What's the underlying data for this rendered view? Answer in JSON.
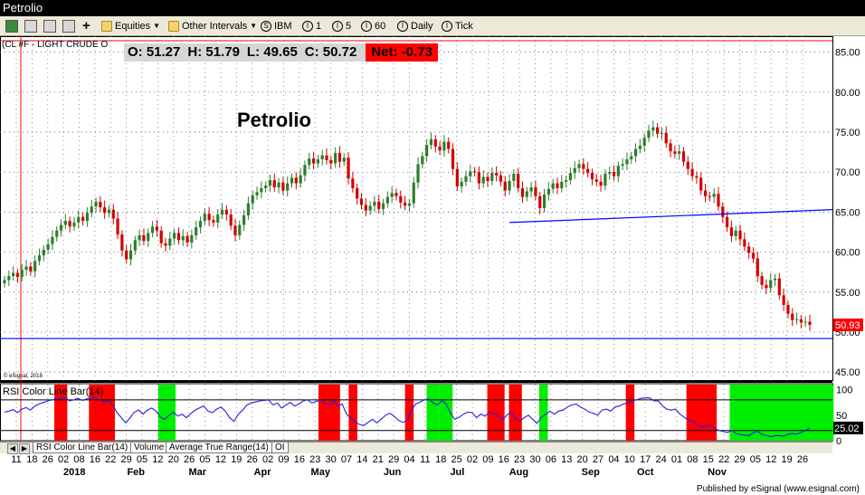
{
  "window": {
    "title": "Petrolio"
  },
  "toolbar": {
    "items": [
      {
        "name": "equities-menu",
        "label": "Equities",
        "icon": "folder-icon",
        "dropdown": true
      },
      {
        "name": "other-intervals-menu",
        "label": "Other Intervals",
        "icon": "folder-icon",
        "dropdown": true
      },
      {
        "name": "ibm-symbol",
        "label": "IBM",
        "icon": "circle-s-icon",
        "glyph": "S"
      },
      {
        "name": "interval-1",
        "label": "1",
        "icon": "circle-i-icon",
        "glyph": "I"
      },
      {
        "name": "interval-5",
        "label": "5",
        "icon": "circle-i-icon",
        "glyph": "I"
      },
      {
        "name": "interval-60",
        "label": "60",
        "icon": "circle-i-icon",
        "glyph": "I"
      },
      {
        "name": "interval-daily",
        "label": "Daily",
        "icon": "circle-i-icon",
        "glyph": "I"
      },
      {
        "name": "interval-tick",
        "label": "Tick",
        "icon": "circle-i-icon",
        "glyph": "I"
      }
    ]
  },
  "quote": {
    "symbol_label": "(CL #F - LIGHT CRUDE O",
    "open_label": "O: 51.27",
    "high_label": "H: 51.79",
    "low_label": "L: 49.65",
    "close_label": "C: 50.72",
    "net_label": "Net: -0.73"
  },
  "colors": {
    "up": "#2e7d2e",
    "down": "#d10000",
    "trend": "#0000ff",
    "rsi_line": "#2222dd",
    "rsi_ob": "#ff0000",
    "rsi_os": "#00ee00"
  },
  "chart_data": [
    {
      "type": "candlestick",
      "title": "Petrolio",
      "copyright": "© eSignal, 2018",
      "ylim": [
        44,
        87
      ],
      "yticks": [
        "85.00",
        "80.00",
        "75.00",
        "70.00",
        "65.00",
        "60.00",
        "55.00",
        "50.00",
        "45.00"
      ],
      "ytick_values": [
        85,
        80,
        75,
        70,
        65,
        60,
        55,
        50,
        45
      ],
      "last_price_label": "50.93",
      "support_line": 49.2,
      "trendline": {
        "from": [
          116,
          63.7
        ],
        "to": [
          231,
          66.2
        ]
      },
      "close": [
        56.5,
        57.0,
        57.4,
        56.9,
        57.8,
        58.2,
        57.6,
        58.9,
        59.6,
        60.3,
        61.0,
        61.9,
        62.7,
        63.4,
        63.9,
        63.2,
        63.7,
        64.4,
        63.9,
        64.9,
        65.7,
        66.3,
        65.6,
        64.9,
        65.3,
        64.2,
        62.2,
        60.2,
        59.1,
        60.2,
        61.5,
        62.1,
        61.4,
        62.4,
        63.2,
        62.7,
        61.1,
        60.8,
        61.7,
        62.4,
        61.5,
        62.0,
        61.2,
        62.1,
        63.1,
        63.9,
        64.8,
        64.0,
        63.7,
        64.7,
        65.3,
        64.7,
        63.3,
        62.1,
        63.4,
        64.6,
        66.1,
        67.1,
        67.5,
        68.0,
        68.3,
        69.0,
        68.1,
        68.7,
        67.7,
        68.6,
        69.3,
        68.6,
        69.6,
        70.9,
        71.7,
        71.1,
        71.6,
        72.1,
        71.5,
        71.1,
        72.4,
        71.3,
        71.8,
        69.2,
        68.0,
        66.7,
        65.9,
        65.2,
        65.8,
        66.3,
        65.4,
        66.1,
        66.9,
        67.4,
        67.0,
        66.2,
        65.8,
        66.1,
        68.7,
        71.0,
        72.0,
        73.4,
        74.1,
        73.2,
        72.7,
        73.8,
        72.9,
        70.4,
        68.2,
        68.8,
        69.5,
        70.1,
        70.0,
        68.6,
        69.4,
        68.9,
        69.9,
        69.6,
        68.8,
        67.7,
        68.9,
        69.8,
        68.0,
        66.9,
        67.6,
        68.1,
        67.0,
        65.5,
        67.2,
        67.9,
        68.6,
        68.0,
        68.8,
        69.0,
        69.9,
        70.5,
        71.0,
        70.4,
        69.9,
        69.1,
        68.8,
        68.3,
        69.8,
        70.0,
        69.5,
        70.8,
        71.0,
        71.6,
        72.0,
        72.9,
        73.3,
        74.3,
        75.2,
        75.6,
        74.8,
        74.9,
        73.6,
        72.6,
        72.3,
        72.6,
        71.3,
        70.4,
        69.5,
        69.3,
        67.7,
        67.0,
        66.9,
        67.3,
        65.7,
        64.4,
        63.1,
        62.0,
        62.7,
        61.6,
        60.7,
        59.9,
        59.2,
        57.0,
        55.9,
        55.5,
        56.5,
        56.7,
        54.6,
        53.4,
        52.3,
        51.5,
        51.6,
        51.2,
        51.3,
        50.9
      ]
    },
    {
      "type": "line",
      "title": "RSI Color Line Bar(14)",
      "ylim": [
        0,
        110
      ],
      "yticks": [
        "100",
        "50",
        "0"
      ],
      "ytick_values": [
        100,
        50,
        0
      ],
      "reference_lines": [
        80,
        20
      ],
      "last_value_label": "25.02",
      "overbought_bars": [
        [
          12,
          14
        ],
        [
          20,
          25
        ],
        [
          73,
          74
        ],
        [
          75,
          77
        ],
        [
          80,
          81
        ],
        [
          93,
          94
        ],
        [
          112,
          115
        ],
        [
          117,
          119
        ],
        [
          144,
          145
        ],
        [
          158,
          164
        ]
      ],
      "oversold_bars": [
        [
          36,
          39
        ],
        [
          98,
          100
        ],
        [
          101,
          103
        ],
        [
          124,
          125
        ],
        [
          168,
          191
        ]
      ],
      "values": [
        56,
        58,
        61,
        55,
        62,
        65,
        60,
        68,
        72,
        75,
        78,
        80,
        82,
        84,
        85,
        78,
        80,
        83,
        79,
        82,
        84,
        85,
        80,
        76,
        78,
        70,
        55,
        45,
        35,
        45,
        56,
        60,
        52,
        60,
        64,
        58,
        46,
        42,
        50,
        56,
        48,
        52,
        45,
        53,
        60,
        64,
        68,
        58,
        55,
        62,
        66,
        58,
        45,
        38,
        52,
        60,
        70,
        74,
        76,
        78,
        79,
        80,
        70,
        74,
        64,
        70,
        75,
        68,
        72,
        78,
        80,
        74,
        77,
        80,
        74,
        70,
        80,
        68,
        72,
        52,
        44,
        36,
        32,
        30,
        36,
        42,
        35,
        42,
        50,
        54,
        48,
        40,
        36,
        40,
        60,
        72,
        76,
        80,
        82,
        74,
        70,
        78,
        72,
        54,
        42,
        46,
        52,
        56,
        55,
        45,
        52,
        48,
        56,
        54,
        48,
        40,
        50,
        56,
        44,
        38,
        45,
        50,
        42,
        34,
        46,
        52,
        58,
        52,
        58,
        60,
        66,
        70,
        72,
        66,
        62,
        56,
        54,
        50,
        60,
        62,
        58,
        66,
        68,
        72,
        74,
        78,
        80,
        83,
        84,
        84,
        78,
        78,
        68,
        62,
        60,
        62,
        52,
        46,
        40,
        38,
        30,
        28,
        28,
        31,
        24,
        20,
        18,
        16,
        20,
        14,
        12,
        11,
        10,
        16,
        18,
        12,
        10,
        8,
        10,
        10,
        9,
        13,
        14,
        13,
        16,
        20,
        25
      ]
    }
  ],
  "x_axis": {
    "day_labels": [
      "11",
      "18",
      "26",
      "02",
      "08",
      "16",
      "22",
      "29",
      "05",
      "12",
      "20",
      "26",
      "05",
      "12",
      "19",
      "26",
      "02",
      "09",
      "16",
      "23",
      "30",
      "07",
      "14",
      "21",
      "29",
      "04",
      "11",
      "18",
      "25",
      "02",
      "09",
      "16",
      "23",
      "30",
      "06",
      "13",
      "20",
      "27",
      "04",
      "10",
      "17",
      "24",
      "01",
      "08",
      "15",
      "22",
      "29",
      "05",
      "12",
      "19",
      "26"
    ],
    "months": [
      {
        "label": "2018",
        "at": 17
      },
      {
        "label": "Feb",
        "at": 35
      },
      {
        "label": "Mar",
        "at": 53
      },
      {
        "label": "Apr",
        "at": 72
      },
      {
        "label": "May",
        "at": 89
      },
      {
        "label": "Jun",
        "at": 110
      },
      {
        "label": "Jul",
        "at": 129
      },
      {
        "label": "Aug",
        "at": 147
      },
      {
        "label": "Sep",
        "at": 168
      },
      {
        "label": "Oct",
        "at": 184
      },
      {
        "label": "Nov",
        "at": 205
      }
    ]
  },
  "tabs": [
    "RSI Color Line Bar(14)",
    "Volume",
    "Average True Range(14)",
    "OI"
  ],
  "footer": "Published by eSignal (www.esignal.com)"
}
